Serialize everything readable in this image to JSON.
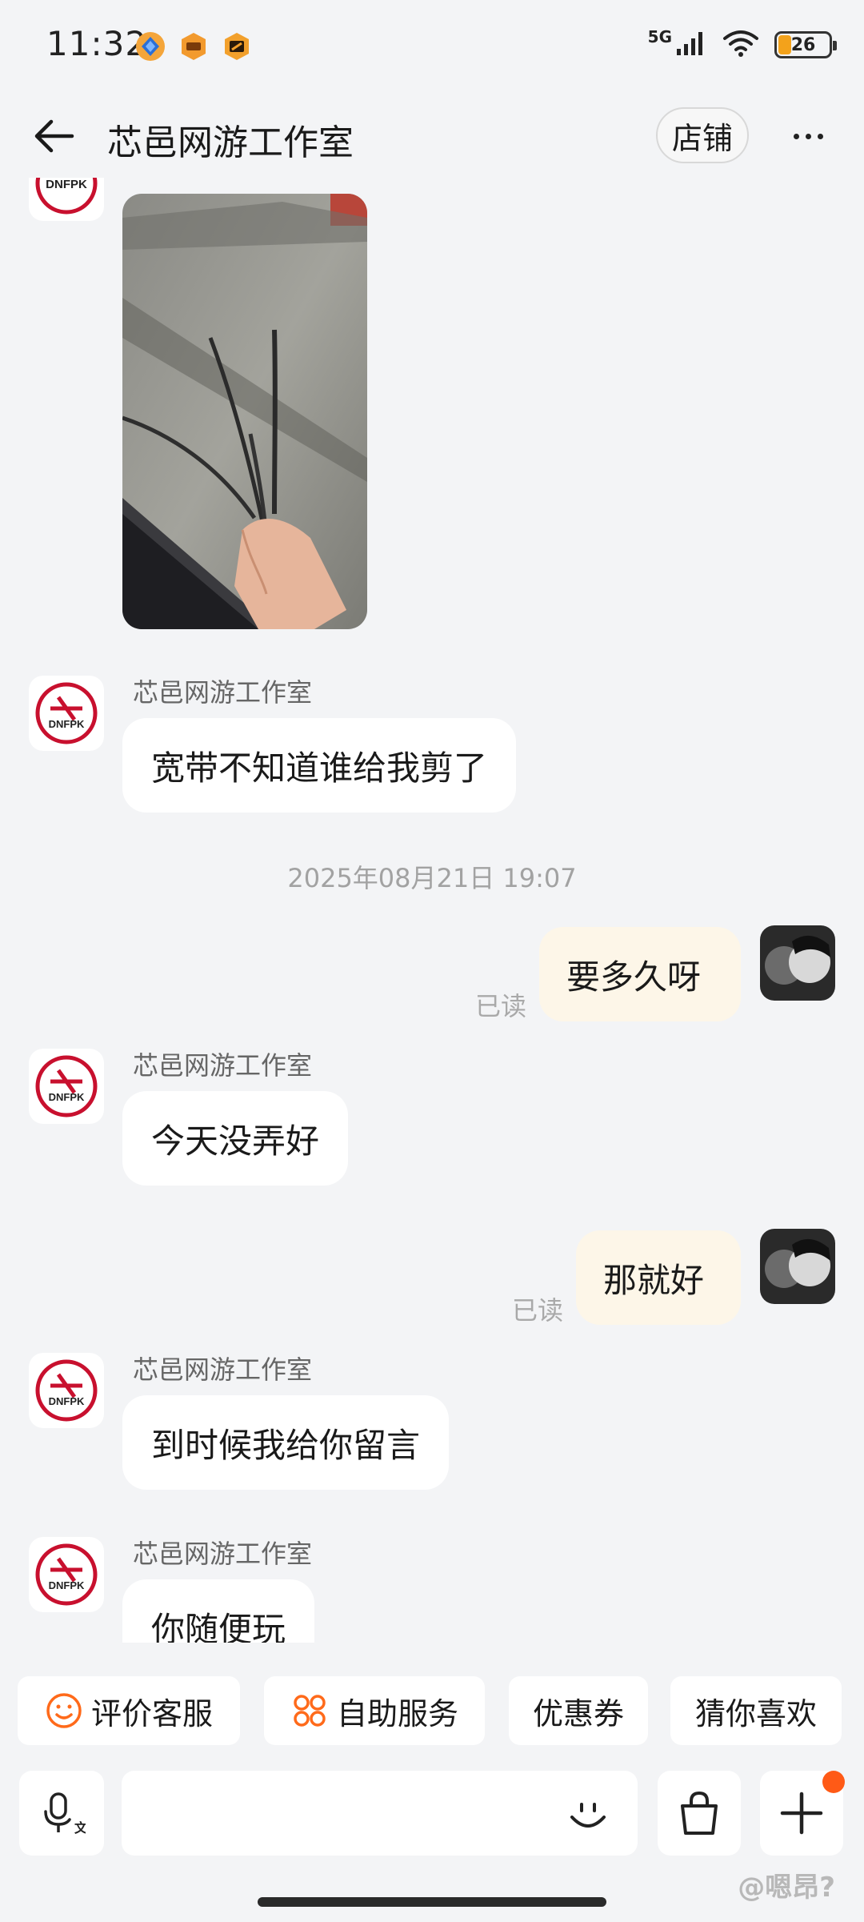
{
  "status_bar": {
    "time": "11:32",
    "network": "5G",
    "battery": "26",
    "app_icons": [
      "blue-diamond-app-icon",
      "orange-hexagon-app-icon",
      "orange-square-app-icon"
    ]
  },
  "header": {
    "title": "芯邑网游工作室",
    "store_label": "店铺"
  },
  "messages": [
    {
      "type": "image",
      "from": "shop",
      "alt": "cable photo"
    },
    {
      "type": "text",
      "from": "shop",
      "sender": "芯邑网游工作室",
      "text": "宽带不知道谁给我剪了"
    },
    {
      "type": "timestamp",
      "text": "2025年08月21日 19:07"
    },
    {
      "type": "text",
      "from": "me",
      "text": "要多久呀",
      "read": "已读"
    },
    {
      "type": "text",
      "from": "shop",
      "sender": "芯邑网游工作室",
      "text": "今天没弄好"
    },
    {
      "type": "text",
      "from": "me",
      "text": "那就好",
      "read": "已读"
    },
    {
      "type": "text",
      "from": "shop",
      "sender": "芯邑网游工作室",
      "text": "到时候我给你留言"
    },
    {
      "type": "text",
      "from": "shop",
      "sender": "芯邑网游工作室",
      "text": "你随便玩"
    }
  ],
  "quick_actions": [
    {
      "label": "评价客服",
      "icon": "smiley-icon"
    },
    {
      "label": "自助服务",
      "icon": "grid-dots-icon"
    },
    {
      "label": "优惠券"
    },
    {
      "label": "猜你喜欢"
    }
  ],
  "input": {
    "value": "",
    "placeholder": ""
  },
  "shop_logo_text": "DNFPK",
  "watermark": "@嗯昂?",
  "colors": {
    "background": "#f3f4f6",
    "incoming_bubble": "#ffffff",
    "outgoing_bubble": "#fdf6e8",
    "accent": "#ff5a16",
    "logo_red": "#c8102e"
  }
}
